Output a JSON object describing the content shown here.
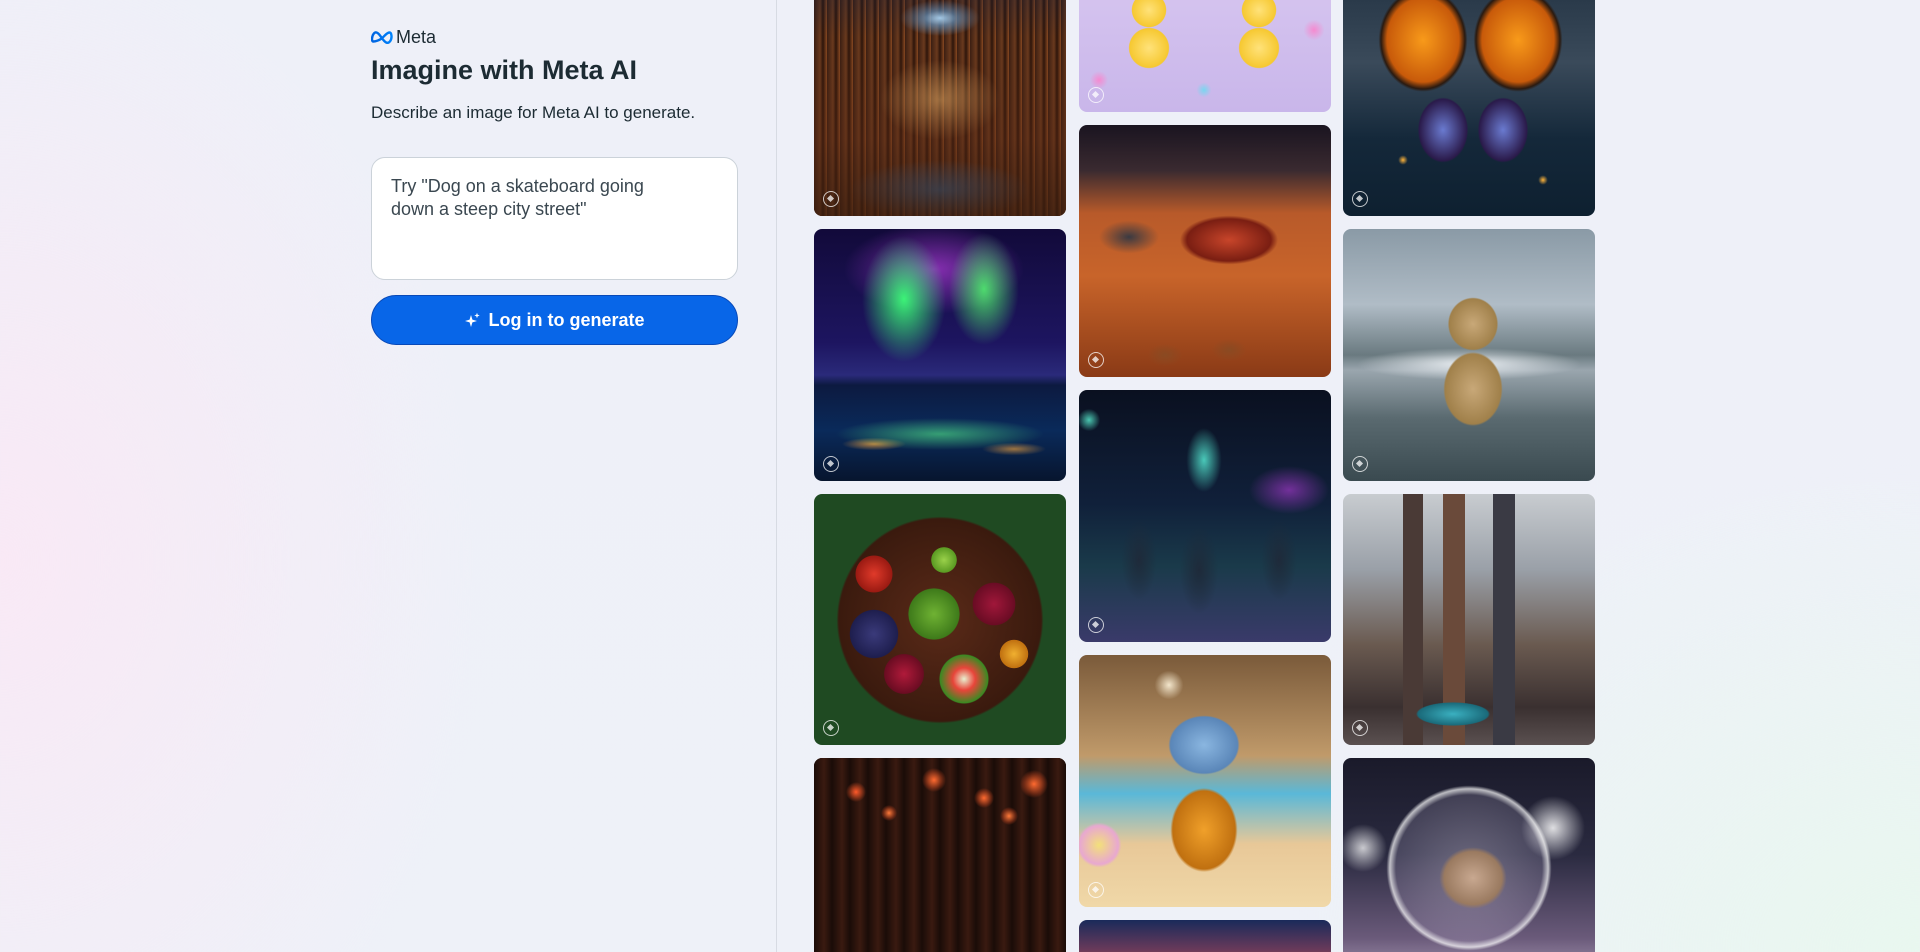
{
  "brand": {
    "logo_icon": "meta-infinity-logo",
    "name": "Meta",
    "accent_color": "#0866e8"
  },
  "hero": {
    "title": "Imagine with Meta AI",
    "subtitle": "Describe an image for Meta AI to generate."
  },
  "prompt": {
    "placeholder": "Try \"Dog on a skateboard going down a steep city street\"",
    "value": ""
  },
  "generate_button": {
    "icon": "sparkle-icon",
    "label": "Log in to generate"
  },
  "gallery": {
    "columns": [
      [
        "library",
        "aurora-over-lake",
        "fruit-platter",
        "lantern-hall"
      ],
      [
        "rubber-ducks",
        "mars-race-cars",
        "space-cats",
        "fluffy-bird",
        "castle"
      ],
      [
        "butterfly",
        "dog-in-sea",
        "futuristic-city",
        "cat-astronaut"
      ]
    ],
    "badge_icon": "imagine-badge-icon"
  }
}
